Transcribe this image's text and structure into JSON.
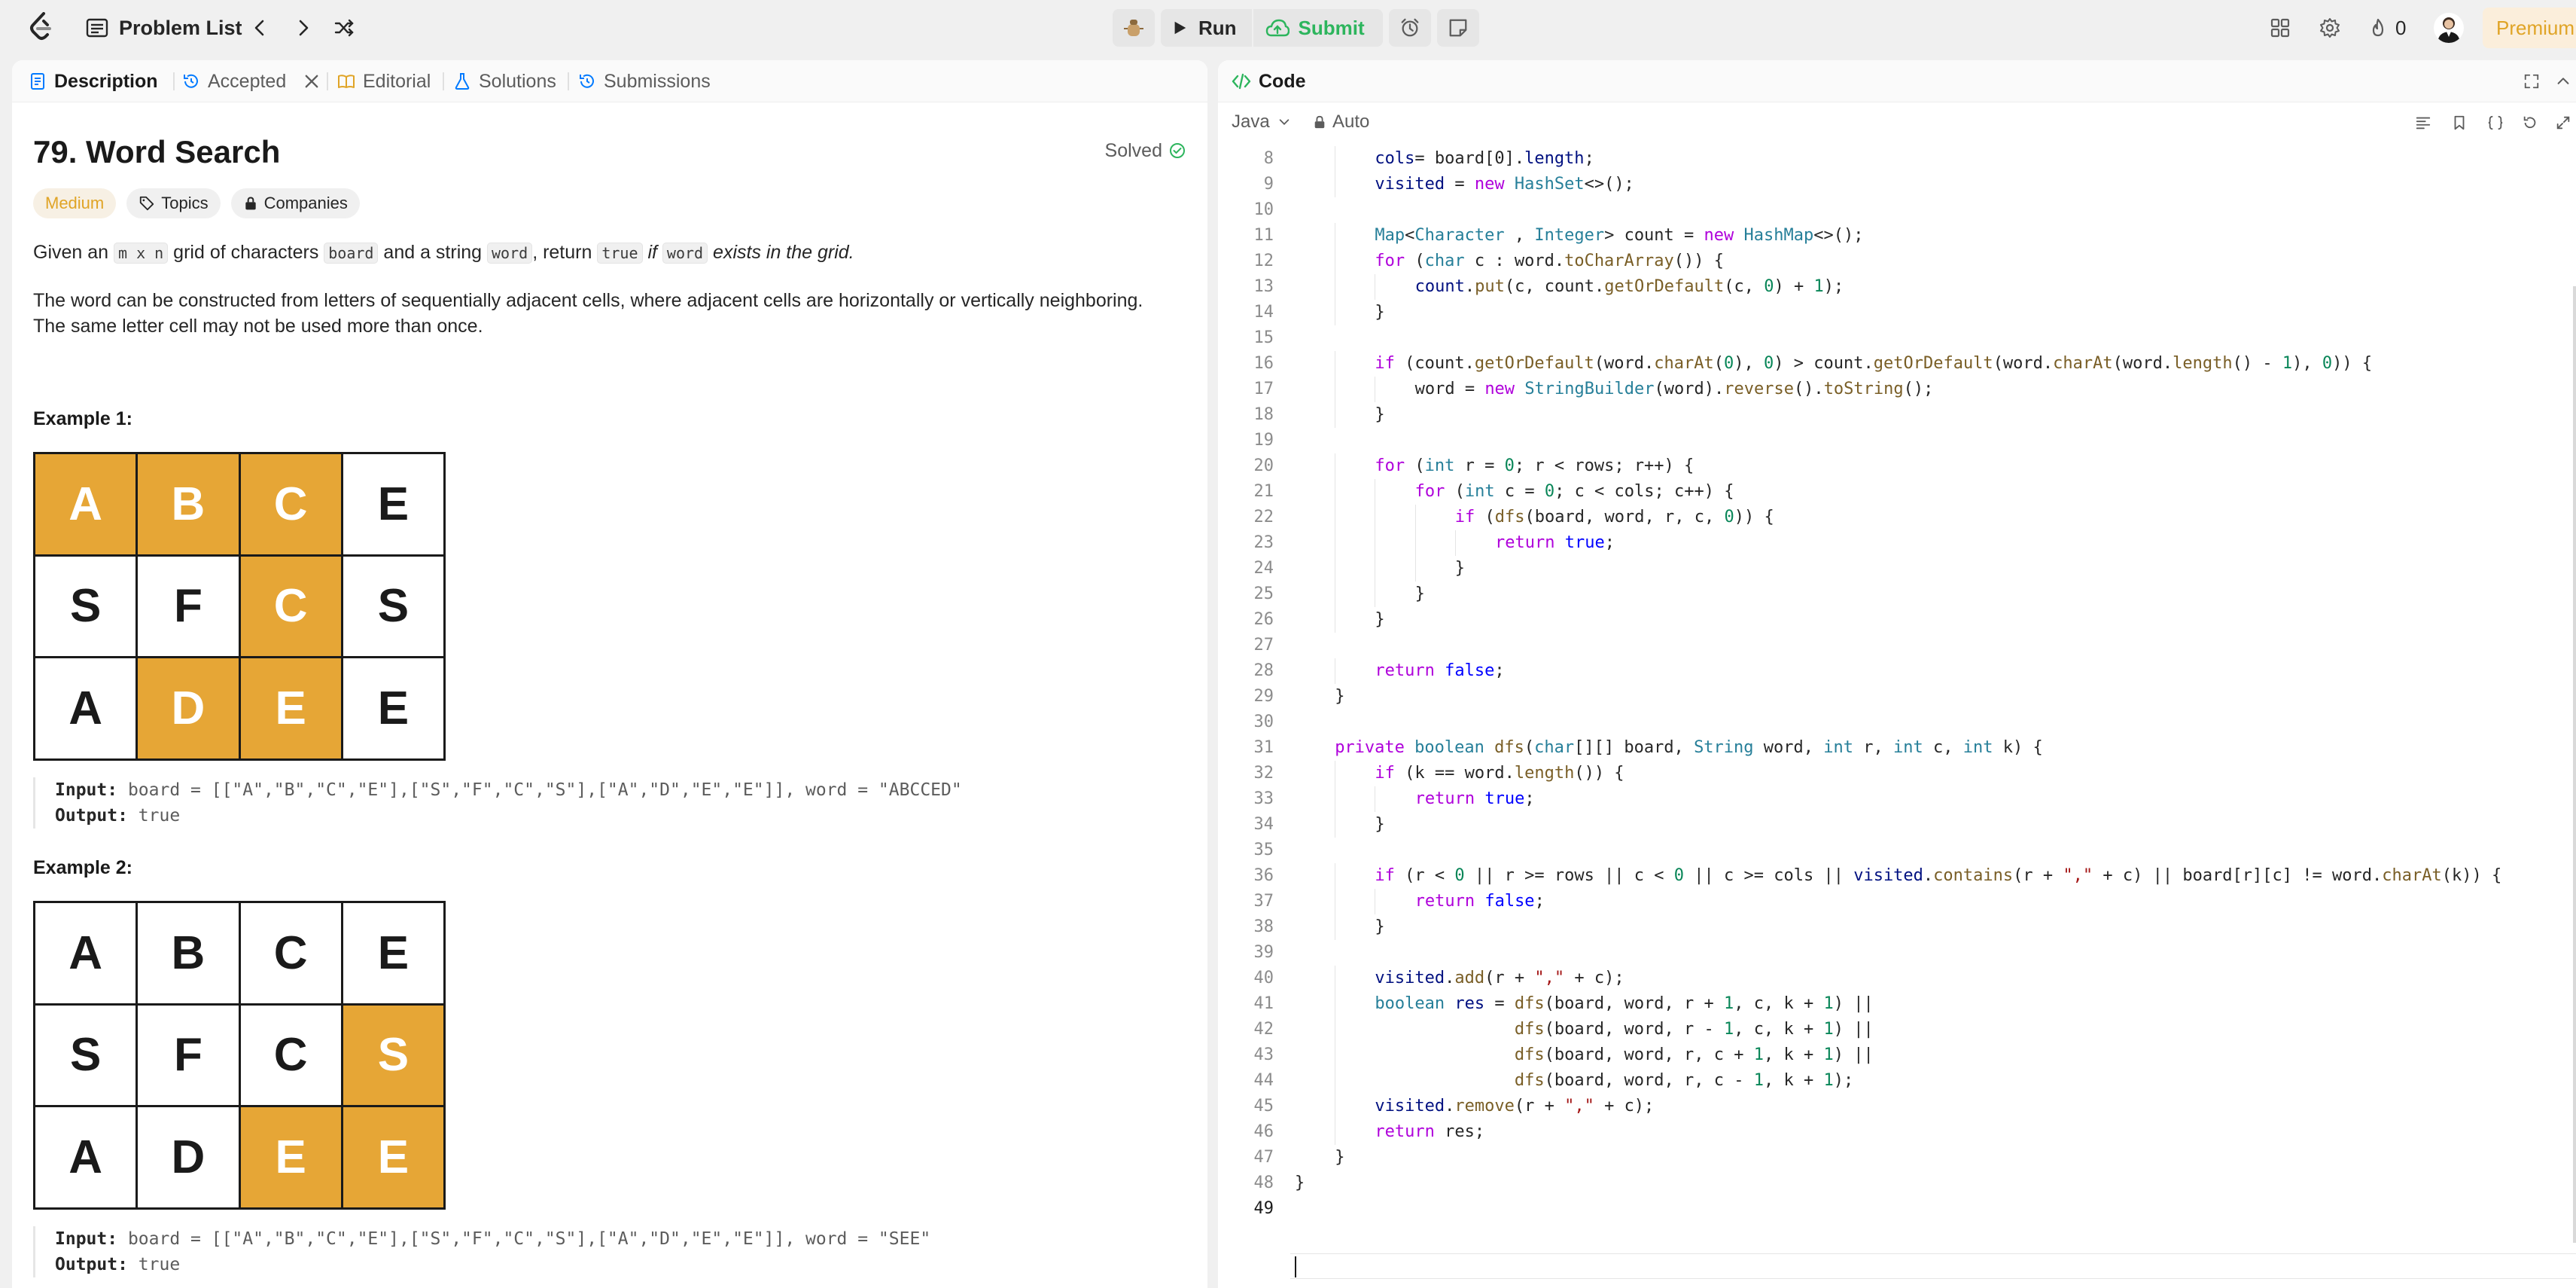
{
  "nav": {
    "problem_list": "Problem List",
    "run": "Run",
    "submit": "Submit",
    "streak": "0",
    "premium": "Premium"
  },
  "tabs": [
    {
      "label": "Description",
      "active": true
    },
    {
      "label": "Accepted"
    },
    {
      "label": "Editorial"
    },
    {
      "label": "Solutions"
    },
    {
      "label": "Submissions"
    }
  ],
  "problem": {
    "title": "79. Word Search",
    "status": "Solved",
    "difficulty": "Medium",
    "topics": "Topics",
    "companies": "Companies",
    "desc1": {
      "a": "Given an ",
      "mn": "m x n",
      "b": " grid of characters ",
      "board": "board",
      "c": " and a string ",
      "word": "word",
      "d": ", return ",
      "true": "true",
      "e": " if ",
      "word2": "word",
      "f": " exists in the grid."
    },
    "desc2_line1": "The word can be constructed from letters of sequentially adjacent cells, where adjacent cells are horizontally or vertically neighboring.",
    "desc2_line2": "The same letter cell may not be used more than once.",
    "examples": [
      {
        "title": "Example 1:",
        "grid": [
          [
            "A",
            "B",
            "C",
            "E"
          ],
          [
            "S",
            "F",
            "C",
            "S"
          ],
          [
            "A",
            "D",
            "E",
            "E"
          ]
        ],
        "highlight": [
          [
            1,
            1,
            1,
            0
          ],
          [
            0,
            0,
            1,
            0
          ],
          [
            0,
            1,
            1,
            0
          ]
        ],
        "input_label": "Input:",
        "input": " board = [[\"A\",\"B\",\"C\",\"E\"],[\"S\",\"F\",\"C\",\"S\"],[\"A\",\"D\",\"E\",\"E\"]], word = \"ABCCED\"",
        "output_label": "Output:",
        "output": " true"
      },
      {
        "title": "Example 2:",
        "grid": [
          [
            "A",
            "B",
            "C",
            "E"
          ],
          [
            "S",
            "F",
            "C",
            "S"
          ],
          [
            "A",
            "D",
            "E",
            "E"
          ]
        ],
        "highlight": [
          [
            0,
            0,
            0,
            0
          ],
          [
            0,
            0,
            0,
            1
          ],
          [
            0,
            0,
            1,
            1
          ]
        ],
        "input_label": "Input:",
        "input": " board = [[\"A\",\"B\",\"C\",\"E\"],[\"S\",\"F\",\"C\",\"S\"],[\"A\",\"D\",\"E\",\"E\"]], word = \"SEE\"",
        "output_label": "Output:",
        "output": " true"
      }
    ]
  },
  "editor": {
    "tab": "Code",
    "language": "Java",
    "mode": "Auto",
    "lines": [
      {
        "n": "8",
        "i": 2,
        "tokens": [
          [
            "v",
            "cols"
          ],
          [
            "",
            "= board[0]."
          ],
          [
            "v",
            "length"
          ],
          [
            "",
            ";"
          ]
        ]
      },
      {
        "n": "9",
        "i": 2,
        "tokens": [
          [
            "v",
            "visited"
          ],
          [
            "",
            " = "
          ],
          [
            "k",
            "new"
          ],
          [
            "",
            " "
          ],
          [
            "t",
            "HashSet"
          ],
          [
            "",
            "<>();"
          ]
        ]
      },
      {
        "n": "10",
        "i": 0,
        "tokens": []
      },
      {
        "n": "11",
        "i": 2,
        "tokens": [
          [
            "t",
            "Map"
          ],
          [
            "",
            "<"
          ],
          [
            "t",
            "Character"
          ],
          [
            "",
            " , "
          ],
          [
            "t",
            "Integer"
          ],
          [
            "",
            "> count = "
          ],
          [
            "k",
            "new"
          ],
          [
            "",
            " "
          ],
          [
            "t",
            "HashMap"
          ],
          [
            "",
            "<>();"
          ]
        ]
      },
      {
        "n": "12",
        "i": 2,
        "tokens": [
          [
            "k",
            "for"
          ],
          [
            "",
            " ("
          ],
          [
            "t",
            "char"
          ],
          [
            "",
            " c : word."
          ],
          [
            "f",
            "toCharArray"
          ],
          [
            "",
            "()) {"
          ]
        ]
      },
      {
        "n": "13",
        "i": 3,
        "tokens": [
          [
            "v",
            "count"
          ],
          [
            "",
            "."
          ],
          [
            "f",
            "put"
          ],
          [
            "",
            "(c, count."
          ],
          [
            "f",
            "getOrDefault"
          ],
          [
            "",
            "(c, "
          ],
          [
            "n",
            "0"
          ],
          [
            "",
            ") + "
          ],
          [
            "n",
            "1"
          ],
          [
            "",
            ");"
          ]
        ]
      },
      {
        "n": "14",
        "i": 2,
        "tokens": [
          [
            "",
            "}"
          ]
        ]
      },
      {
        "n": "15",
        "i": 0,
        "tokens": []
      },
      {
        "n": "16",
        "i": 2,
        "tokens": [
          [
            "k",
            "if"
          ],
          [
            "",
            " (count."
          ],
          [
            "f",
            "getOrDefault"
          ],
          [
            "",
            "(word."
          ],
          [
            "f",
            "charAt"
          ],
          [
            "",
            "("
          ],
          [
            "n",
            "0"
          ],
          [
            "",
            "), "
          ],
          [
            "n",
            "0"
          ],
          [
            "",
            ") > count."
          ],
          [
            "f",
            "getOrDefault"
          ],
          [
            "",
            "(word."
          ],
          [
            "f",
            "charAt"
          ],
          [
            "",
            "(word."
          ],
          [
            "f",
            "length"
          ],
          [
            "",
            "() - "
          ],
          [
            "n",
            "1"
          ],
          [
            "",
            "), "
          ],
          [
            "n",
            "0"
          ],
          [
            "",
            ")) {"
          ]
        ]
      },
      {
        "n": "17",
        "i": 3,
        "tokens": [
          [
            "",
            "word = "
          ],
          [
            "k",
            "new"
          ],
          [
            "",
            " "
          ],
          [
            "t",
            "StringBuilder"
          ],
          [
            "",
            "(word)."
          ],
          [
            "f",
            "reverse"
          ],
          [
            "",
            "()."
          ],
          [
            "f",
            "toString"
          ],
          [
            "",
            "();"
          ]
        ]
      },
      {
        "n": "18",
        "i": 2,
        "tokens": [
          [
            "",
            "}"
          ]
        ]
      },
      {
        "n": "19",
        "i": 0,
        "tokens": []
      },
      {
        "n": "20",
        "i": 2,
        "tokens": [
          [
            "k",
            "for"
          ],
          [
            "",
            " ("
          ],
          [
            "t",
            "int"
          ],
          [
            "",
            " r = "
          ],
          [
            "n",
            "0"
          ],
          [
            "",
            "; r < rows; r++) {"
          ]
        ]
      },
      {
        "n": "21",
        "i": 3,
        "tokens": [
          [
            "k",
            "for"
          ],
          [
            "",
            " ("
          ],
          [
            "t",
            "int"
          ],
          [
            "",
            " c = "
          ],
          [
            "n",
            "0"
          ],
          [
            "",
            "; c < cols; c++) {"
          ]
        ]
      },
      {
        "n": "22",
        "i": 4,
        "tokens": [
          [
            "k",
            "if"
          ],
          [
            "",
            " ("
          ],
          [
            "f",
            "dfs"
          ],
          [
            "",
            "(board, word, r, c, "
          ],
          [
            "n",
            "0"
          ],
          [
            "",
            ")) {"
          ]
        ]
      },
      {
        "n": "23",
        "i": 5,
        "tokens": [
          [
            "k",
            "return"
          ],
          [
            "",
            " "
          ],
          [
            "b",
            "true"
          ],
          [
            "",
            ";"
          ]
        ]
      },
      {
        "n": "24",
        "i": 4,
        "tokens": [
          [
            "",
            "}"
          ]
        ]
      },
      {
        "n": "25",
        "i": 3,
        "tokens": [
          [
            "",
            "}"
          ]
        ]
      },
      {
        "n": "26",
        "i": 2,
        "tokens": [
          [
            "",
            "}"
          ]
        ]
      },
      {
        "n": "27",
        "i": 0,
        "tokens": []
      },
      {
        "n": "28",
        "i": 2,
        "tokens": [
          [
            "k",
            "return"
          ],
          [
            "",
            " "
          ],
          [
            "b",
            "false"
          ],
          [
            "",
            ";"
          ]
        ]
      },
      {
        "n": "29",
        "i": 1,
        "tokens": [
          [
            "",
            "}"
          ]
        ]
      },
      {
        "n": "30",
        "i": 0,
        "tokens": []
      },
      {
        "n": "31",
        "i": 1,
        "tokens": [
          [
            "k",
            "private"
          ],
          [
            "",
            " "
          ],
          [
            "t",
            "boolean"
          ],
          [
            "",
            " "
          ],
          [
            "f",
            "dfs"
          ],
          [
            "",
            "("
          ],
          [
            "t",
            "char"
          ],
          [
            "",
            "[][] board, "
          ],
          [
            "t",
            "String"
          ],
          [
            "",
            " word, "
          ],
          [
            "t",
            "int"
          ],
          [
            "",
            " r, "
          ],
          [
            "t",
            "int"
          ],
          [
            "",
            " c, "
          ],
          [
            "t",
            "int"
          ],
          [
            "",
            " k) {"
          ]
        ]
      },
      {
        "n": "32",
        "i": 2,
        "tokens": [
          [
            "k",
            "if"
          ],
          [
            "",
            " (k == word."
          ],
          [
            "f",
            "length"
          ],
          [
            "",
            "()) {"
          ]
        ]
      },
      {
        "n": "33",
        "i": 3,
        "tokens": [
          [
            "k",
            "return"
          ],
          [
            "",
            " "
          ],
          [
            "b",
            "true"
          ],
          [
            "",
            ";"
          ]
        ]
      },
      {
        "n": "34",
        "i": 2,
        "tokens": [
          [
            "",
            "}"
          ]
        ]
      },
      {
        "n": "35",
        "i": 0,
        "tokens": []
      },
      {
        "n": "36",
        "i": 2,
        "tokens": [
          [
            "k",
            "if"
          ],
          [
            "",
            " (r < "
          ],
          [
            "n",
            "0"
          ],
          [
            "",
            " || r >= rows || c < "
          ],
          [
            "n",
            "0"
          ],
          [
            "",
            " || c >= cols || "
          ],
          [
            "v",
            "visited"
          ],
          [
            "",
            "."
          ],
          [
            "f",
            "contains"
          ],
          [
            "",
            "(r + "
          ],
          [
            "s",
            "\",\""
          ],
          [
            "",
            " + c) || board[r][c] != word."
          ],
          [
            "f",
            "charAt"
          ],
          [
            "",
            "(k)) {"
          ]
        ]
      },
      {
        "n": "37",
        "i": 3,
        "tokens": [
          [
            "k",
            "return"
          ],
          [
            "",
            " "
          ],
          [
            "b",
            "false"
          ],
          [
            "",
            ";"
          ]
        ]
      },
      {
        "n": "38",
        "i": 2,
        "tokens": [
          [
            "",
            "}"
          ]
        ]
      },
      {
        "n": "39",
        "i": 0,
        "tokens": []
      },
      {
        "n": "40",
        "i": 2,
        "tokens": [
          [
            "v",
            "visited"
          ],
          [
            "",
            "."
          ],
          [
            "f",
            "add"
          ],
          [
            "",
            "(r + "
          ],
          [
            "s",
            "\",\""
          ],
          [
            "",
            " + c);"
          ]
        ]
      },
      {
        "n": "41",
        "i": 2,
        "tokens": [
          [
            "t",
            "boolean"
          ],
          [
            "",
            " "
          ],
          [
            "v",
            "res"
          ],
          [
            "",
            " = "
          ],
          [
            "f",
            "dfs"
          ],
          [
            "",
            "(board, word, r + "
          ],
          [
            "n",
            "1"
          ],
          [
            "",
            ", c, k + "
          ],
          [
            "n",
            "1"
          ],
          [
            "",
            ") ||"
          ]
        ]
      },
      {
        "n": "42",
        "i": 2,
        "pad": "              ",
        "tokens": [
          [
            "f",
            "dfs"
          ],
          [
            "",
            "(board, word, r - "
          ],
          [
            "n",
            "1"
          ],
          [
            "",
            ", c, k + "
          ],
          [
            "n",
            "1"
          ],
          [
            "",
            ") ||"
          ]
        ]
      },
      {
        "n": "43",
        "i": 2,
        "pad": "              ",
        "tokens": [
          [
            "f",
            "dfs"
          ],
          [
            "",
            "(board, word, r, c + "
          ],
          [
            "n",
            "1"
          ],
          [
            "",
            ", k + "
          ],
          [
            "n",
            "1"
          ],
          [
            "",
            ") ||"
          ]
        ]
      },
      {
        "n": "44",
        "i": 2,
        "pad": "              ",
        "tokens": [
          [
            "f",
            "dfs"
          ],
          [
            "",
            "(board, word, r, c - "
          ],
          [
            "n",
            "1"
          ],
          [
            "",
            ", k + "
          ],
          [
            "n",
            "1"
          ],
          [
            "",
            ");"
          ]
        ]
      },
      {
        "n": "45",
        "i": 2,
        "tokens": [
          [
            "v",
            "visited"
          ],
          [
            "",
            "."
          ],
          [
            "f",
            "remove"
          ],
          [
            "",
            "(r + "
          ],
          [
            "s",
            "\",\""
          ],
          [
            "",
            " + c);"
          ]
        ]
      },
      {
        "n": "46",
        "i": 2,
        "tokens": [
          [
            "k",
            "return"
          ],
          [
            "",
            " res;"
          ]
        ]
      },
      {
        "n": "47",
        "i": 1,
        "tokens": [
          [
            "",
            "}"
          ]
        ]
      },
      {
        "n": "48",
        "i": 0,
        "tokens": [
          [
            "",
            "}"
          ]
        ]
      },
      {
        "n": "49",
        "i": 0,
        "tokens": []
      }
    ]
  }
}
